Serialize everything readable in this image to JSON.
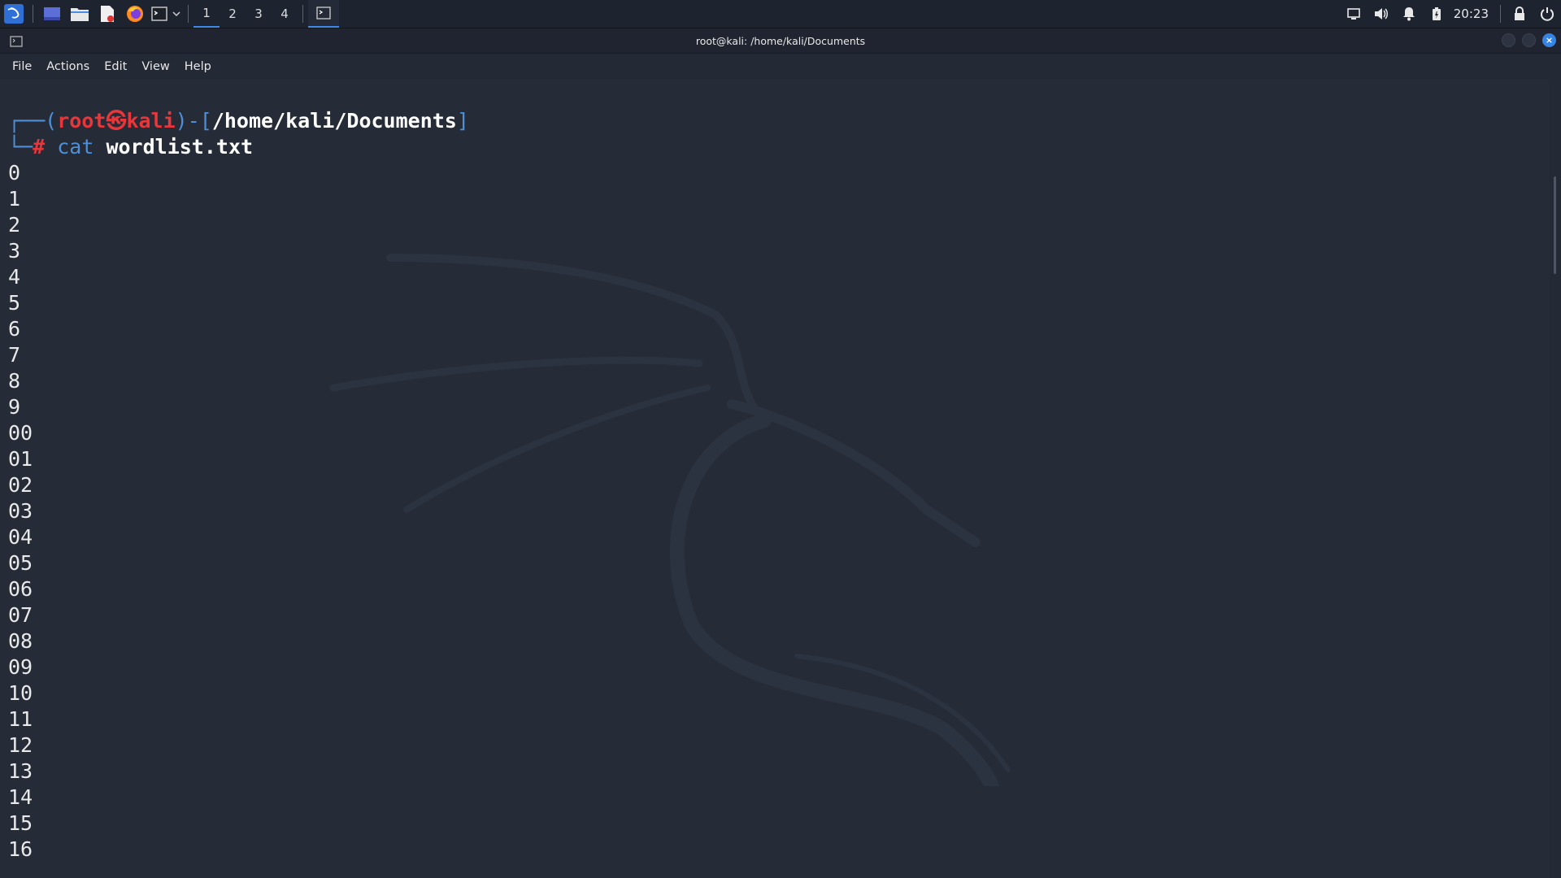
{
  "panel": {
    "workspaces": [
      "1",
      "2",
      "3",
      "4"
    ],
    "active_workspace": "1",
    "clock": "20:23"
  },
  "window": {
    "title": "root@kali: /home/kali/Documents",
    "menu": [
      "File",
      "Actions",
      "Edit",
      "View",
      "Help"
    ]
  },
  "terminal": {
    "prompt": {
      "user": "root",
      "at_symbol": "㉿",
      "host": "kali",
      "path": "/home/kali/Documents",
      "symbol": "#"
    },
    "command": {
      "cmd": "cat",
      "arg": "wordlist.txt"
    },
    "output": [
      "0",
      "1",
      "2",
      "3",
      "4",
      "5",
      "6",
      "7",
      "8",
      "9",
      "00",
      "01",
      "02",
      "03",
      "04",
      "05",
      "06",
      "07",
      "08",
      "09",
      "10",
      "11",
      "12",
      "13",
      "14",
      "15",
      "16"
    ]
  },
  "colors": {
    "accent": "#3d8ae8",
    "prompt_blue": "#4d90d9",
    "prompt_red": "#e8363a",
    "background": "#252b37"
  }
}
